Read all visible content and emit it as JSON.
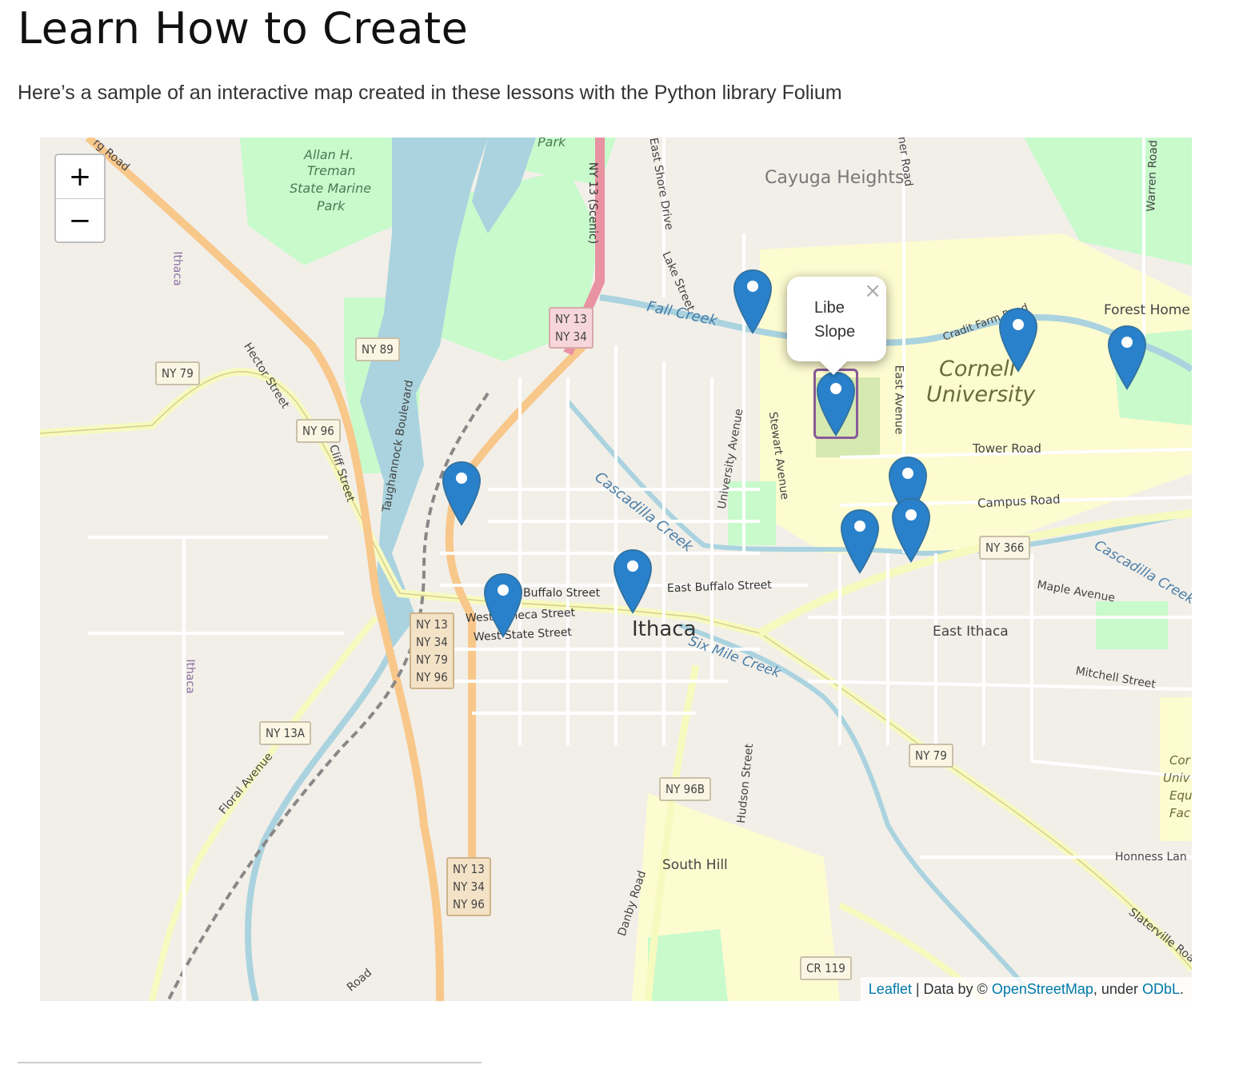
{
  "page": {
    "title": "Learn How to Create",
    "subtitle": "Here’s a sample of an interactive map created in these lessons with the Python library Folium"
  },
  "map": {
    "zoom_in": "+",
    "zoom_out": "−",
    "popup": {
      "text": "Libe Slope",
      "close": "×"
    },
    "attribution": {
      "leaflet": "Leaflet",
      "separator": " | Data by © ",
      "osm": "OpenStreetMap",
      "under": ", under ",
      "odbl": "ODbL",
      "end": "."
    },
    "place_labels": {
      "cayuga_heights": "Cayuga Heights",
      "cornell": "Cornell",
      "university": "University",
      "ithaca": "Ithaca",
      "east_ithaca": "East Ithaca",
      "south_hill": "South Hill",
      "forest_home": "Forest Home",
      "treman_1": "Allan H.",
      "treman_2": "Treman",
      "treman_3": "State Marine",
      "treman_4": "Park",
      "park_top": "Park",
      "ithaca_boundary_1": "Ithaca",
      "ithaca_boundary_2": "Ithaca",
      "cornell_equine_1": "Cor",
      "cornell_equine_2": "Univ",
      "cornell_equine_3": "Equ",
      "cornell_equine_4": "Fac"
    },
    "water_labels": {
      "fall_creek": "Fall Creek",
      "cascadilla_creek": "Cascadilla Creek",
      "cascadilla_creek_east": "Cascadilla Creek",
      "six_mile_creek": "Six Mile Creek"
    },
    "street_labels": {
      "hector": "Hector Street",
      "cliff": "Cliff Street",
      "taughannock": "Taughannock Boulevard",
      "lake": "Lake Street",
      "east_shore": "East Shore Drive",
      "university_ave": "University Avenue",
      "stewart": "Stewart Avenue",
      "east_ave": "East Avenue",
      "tower": "Tower Road",
      "campus": "Campus Road",
      "maple": "Maple Avenue",
      "mitchell": "Mitchell Street",
      "buffalo": "Buffalo Street",
      "east_buffalo": "East Buffalo Street",
      "west_seneca": "West Seneca Street",
      "west_state": "West State Street",
      "floral": "Floral Avenue",
      "hudson": "Hudson Street",
      "danby": "Danby Road",
      "honness": "Honness Lan",
      "slaterville": "Slaterville Roa",
      "warren": "Warren Road",
      "judd_falls": "ner Road",
      "trumansburg": "rg Road",
      "road_bottom": "Road",
      "caldwell": "Cradit Farm Road",
      "ny13_scenic": "NY 13 (Scenic)"
    },
    "route_shields": {
      "ny13_ny34_top": "NY 13\nNY 34",
      "ny89": "NY 89",
      "ny79_west": "NY 79",
      "ny96_west": "NY 96",
      "ny13_34_79_96": "NY 13\nNY 34\nNY 79\nNY 96",
      "ny13a": "NY 13A",
      "ny96b": "NY 96B",
      "ny13_34_96_south": "NY 13\nNY 34\nNY 96",
      "ny366": "NY 366",
      "ny79_east": "NY 79",
      "cr119": "CR 119"
    },
    "markers": [
      {
        "name": "marker-fall-creek",
        "selected": false
      },
      {
        "name": "marker-libe-slope",
        "selected": true
      },
      {
        "name": "marker-beebe-lake",
        "selected": false
      },
      {
        "name": "marker-forest-home",
        "selected": false
      },
      {
        "name": "marker-cascadilla-north",
        "selected": false
      },
      {
        "name": "marker-collegetown",
        "selected": false
      },
      {
        "name": "marker-cascadilla-east",
        "selected": false
      },
      {
        "name": "marker-west-end",
        "selected": false
      },
      {
        "name": "marker-downtown",
        "selected": false
      },
      {
        "name": "marker-west-state",
        "selected": false
      }
    ],
    "colors": {
      "marker": "#2a81cb",
      "water": "#aad3df",
      "park": "#c8facc",
      "campus": "#fdfbd0",
      "land": "#f2efe9"
    }
  }
}
